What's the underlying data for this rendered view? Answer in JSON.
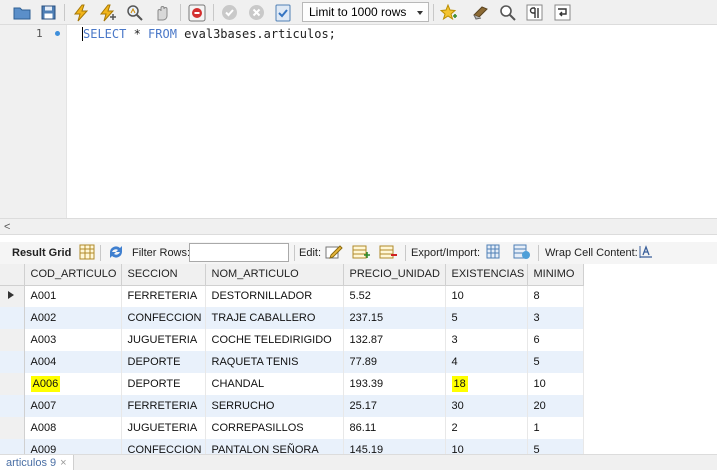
{
  "toolbar": {
    "limit_select": "Limit to 1000 rows",
    "icons": [
      "open-folder-icon",
      "save-icon",
      "execute-icon",
      "execute-statement-icon",
      "explain-icon",
      "stop-icon",
      "toggle-continue-icon",
      "commit-icon",
      "rollback-icon",
      "autocommit-icon",
      "limit-select",
      "beautify-icon",
      "find-icon",
      "invisible-chars-icon",
      "wrap-icon"
    ]
  },
  "editor": {
    "line_number": "1",
    "keyword_select": "SELECT",
    "star": " * ",
    "keyword_from": "FROM",
    "table_ref": " eval3bases.articulos;"
  },
  "result_bar": {
    "title": "Result Grid",
    "filter_label": "Filter Rows:",
    "filter_value": "",
    "edit_label": "Edit:",
    "export_label": "Export/Import:",
    "wrap_label": "Wrap Cell Content:"
  },
  "grid": {
    "columns": [
      "COD_ARTICULO",
      "SECCION",
      "NOM_ARTICULO",
      "PRECIO_UNIDAD",
      "EXISTENCIAS",
      "MINIMO"
    ],
    "rows": [
      [
        "A001",
        "FERRETERIA",
        "DESTORNILLADOR",
        "5.52",
        "10",
        "8"
      ],
      [
        "A002",
        "CONFECCION",
        "TRAJE CABALLERO",
        "237.15",
        "5",
        "3"
      ],
      [
        "A003",
        "JUGUETERIA",
        "COCHE TELEDIRIGIDO",
        "132.87",
        "3",
        "6"
      ],
      [
        "A004",
        "DEPORTE",
        "RAQUETA TENIS",
        "77.89",
        "4",
        "5"
      ],
      [
        "A006",
        "DEPORTE",
        "CHANDAL",
        "193.39",
        "18",
        "10"
      ],
      [
        "A007",
        "FERRETERIA",
        "SERRUCHO",
        "25.17",
        "30",
        "20"
      ],
      [
        "A008",
        "JUGUETERIA",
        "CORREPASILLOS",
        "86.11",
        "2",
        "1"
      ],
      [
        "A009",
        "CONFECCION",
        "PANTALON SEÑORA",
        "145.19",
        "10",
        "5"
      ]
    ],
    "selected_row": 0,
    "highlighted_cells": [
      [
        4,
        0
      ],
      [
        4,
        4
      ]
    ],
    "highlight_color": "#ffff00",
    "alt_row_color": "#e9f1fb"
  },
  "tabs": [
    {
      "label": "articulos 9"
    }
  ]
}
